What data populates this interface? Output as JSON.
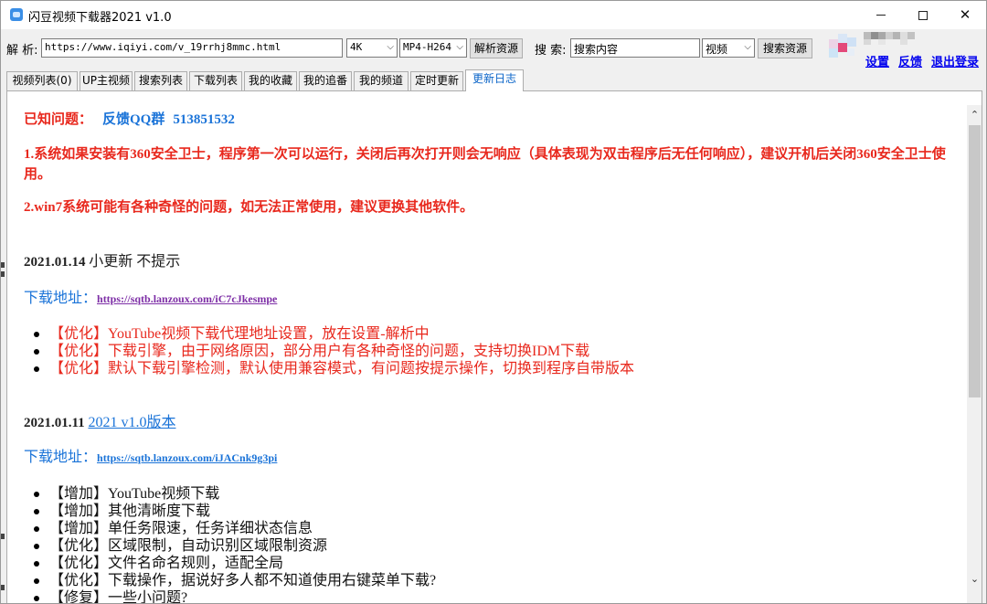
{
  "window": {
    "title": "闪豆视频下载器2021 v1.0"
  },
  "toolbar": {
    "parse_label": "解 析:",
    "url_value": "https://www.iqiyi.com/v_19rrhj8mmc.html",
    "quality_value": "4K",
    "format_value": "MP4-H264",
    "parse_button": "解析资源",
    "search_label": "搜 索:",
    "search_value": "搜索内容",
    "search_type_value": "视频",
    "search_button": "搜索资源"
  },
  "top_links": {
    "settings": "设置",
    "feedback": "反馈",
    "logout": "退出登录"
  },
  "tabs": [
    {
      "label": "视频列表(0)"
    },
    {
      "label": "UP主视频"
    },
    {
      "label": "搜索列表"
    },
    {
      "label": "下载列表"
    },
    {
      "label": "我的收藏"
    },
    {
      "label": "我的追番"
    },
    {
      "label": "我的频道"
    },
    {
      "label": "定时更新"
    },
    {
      "label": "更新日志"
    }
  ],
  "known_issues": {
    "heading": "已知问题：",
    "qq_label": "反馈QQ群",
    "qq_number": "513851532",
    "issue1": "1.系统如果安装有360安全卫士，程序第一次可以运行，关闭后再次打开则会无响应（具体表现为双击程序后无任何响应），建议开机后关闭360安全卫士使用。",
    "issue2": "2.win7系统可能有各种奇怪的问题，如无法正常使用，建议更换其他软件。"
  },
  "releases": [
    {
      "date": "2021.01.14",
      "title": "小更新 不提示",
      "download_label": "下载地址：",
      "download_link": "https://sqtb.lanzoux.com/iC7cJkesmpe",
      "items": [
        "【优化】YouTube视频下载代理地址设置，放在设置-解析中",
        "【优化】下载引擎，由于网络原因，部分用户有各种奇怪的问题，支持切换IDM下载",
        "【优化】默认下载引擎检测，默认使用兼容模式，有问题按提示操作，切换到程序自带版本"
      ]
    },
    {
      "date": "2021.01.11",
      "title": "2021 v1.0版本",
      "download_label": "下载地址：",
      "download_link": "https://sqtb.lanzoux.com/iJACnk9g3pi",
      "items": [
        "【增加】YouTube视频下载",
        "【增加】其他清晰度下载",
        "【增加】单任务限速，任务详细状态信息",
        "【优化】区域限制，自动识别区域限制资源",
        "【优化】文件名命名规则，适配全局",
        "【优化】下载操作，据说好多人都不知道使用右键菜单下载?",
        "【修复】一些小问题?"
      ]
    }
  ],
  "colors": {
    "accent_red": "#e8281d",
    "accent_blue": "#1a73d8",
    "link_purple": "#7d2ea6",
    "link_nav": "#0000ee"
  }
}
